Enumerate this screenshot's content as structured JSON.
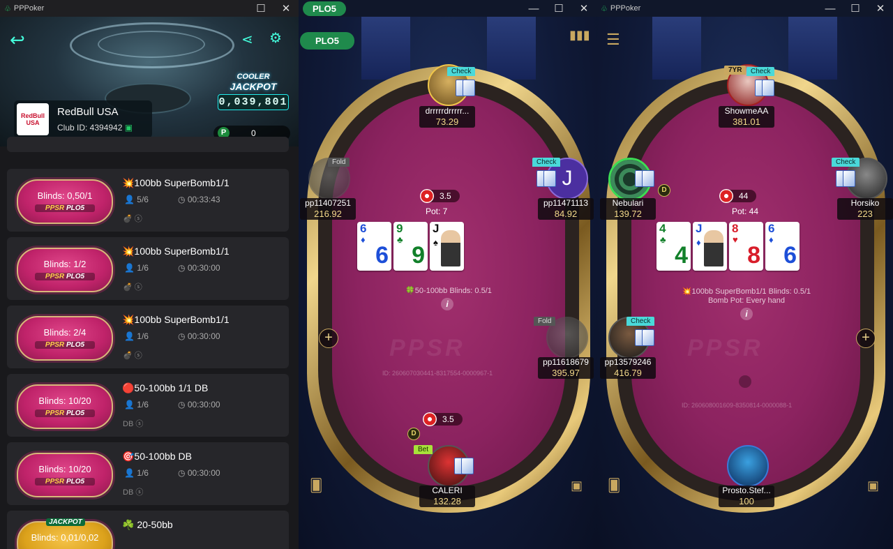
{
  "lobby": {
    "app_title": "PPPoker",
    "club_name": "RedBull USA",
    "club_id": "Club ID: 4394942",
    "club_logo_text": "RedBull USA",
    "jackpot_label_top": "COOLER",
    "jackpot_label": "JACKPOT",
    "jackpot_value": "0,039,801",
    "p_balance": "0",
    "games": [
      {
        "blinds": "Blinds:  0,50/1",
        "brand": "PPSR",
        "variant": "PLO5",
        "title": "💥100bb SuperBomb1/1",
        "players": "5/6",
        "time": "00:33:43",
        "icons": "💣 ⓢ"
      },
      {
        "blinds": "Blinds:  1/2",
        "brand": "PPSR",
        "variant": "PLO5",
        "title": "💥100bb SuperBomb1/1",
        "players": "1/6",
        "time": "00:30:00",
        "icons": "💣 ⓢ"
      },
      {
        "blinds": "Blinds:  2/4",
        "brand": "PPSR",
        "variant": "PLO5",
        "title": "💥100bb SuperBomb1/1",
        "players": "1/6",
        "time": "00:30:00",
        "icons": "💣 ⓢ"
      },
      {
        "blinds": "Blinds:  10/20",
        "brand": "PPSR",
        "variant": "PLO5",
        "title": "🔴50-100bb 1/1 DB",
        "players": "1/6",
        "time": "00:30:00",
        "icons": "DB ⓢ"
      },
      {
        "blinds": "Blinds:  10/20",
        "brand": "PPSR",
        "variant": "PLO5",
        "title": "🎯50-100bb DB",
        "players": "1/6",
        "time": "00:30:00",
        "icons": "DB ⓢ"
      },
      {
        "blinds": "Blinds:  0,01/0,02",
        "brand": "PPSR",
        "variant": "PLO5",
        "title": "☘️ 20-50bb",
        "players": "",
        "time": "",
        "icons": "",
        "jackpot": "JACKPOT"
      }
    ]
  },
  "table1": {
    "tab_label": "PLO5",
    "badge_label": "PLO5",
    "pot_chip_amount": "3.5",
    "pot": "Pot: 7",
    "board": [
      {
        "rank": "6",
        "suit": "♦",
        "color": "#1d4fd8"
      },
      {
        "rank": "9",
        "suit": "♣",
        "color": "#12802a"
      },
      {
        "rank": "J",
        "suit": "♠",
        "color": "#111111",
        "face": true
      }
    ],
    "info": "🍀50-100bb   Blinds: 0.5/1",
    "hand_id": "ID: 260607030441-8317554-0000967-1",
    "watermark": "PPSR",
    "bet_amount": "3.5",
    "players": [
      {
        "name": "drrrrrdrrrrr...",
        "stack": "73.29",
        "action": "Check"
      },
      {
        "name": "pp11407251",
        "stack": "216.92",
        "action": "Fold"
      },
      {
        "name": "pp11471113",
        "stack": "84.92",
        "action": "Check",
        "avatar_letter": "J"
      },
      {
        "name": "pp11618679",
        "stack": "395.97",
        "action": "Fold"
      },
      {
        "name": "CALERI",
        "stack": "132.28",
        "action": "Bet"
      }
    ]
  },
  "table2": {
    "app_title": "PPPoker",
    "pot_chip_amount": "44",
    "pot": "Pot: 44",
    "board": [
      {
        "rank": "4",
        "suit": "♣",
        "color": "#12802a"
      },
      {
        "rank": "J",
        "suit": "♦",
        "color": "#1d4fd8",
        "face": true
      },
      {
        "rank": "8",
        "suit": "♥",
        "color": "#d81d2a"
      },
      {
        "rank": "6",
        "suit": "♦",
        "color": "#1d4fd8"
      }
    ],
    "info": "💥100bb SuperBomb1/1   Blinds: 0.5/1",
    "info2": "Bomb Pot: Every hand",
    "hand_id": "ID: 260608001609-8350814-0000088-1",
    "watermark": "PPSR",
    "players": [
      {
        "name": "ShowmeAA",
        "stack": "381.01",
        "action": "Check",
        "tag": "7YR"
      },
      {
        "name": "Nebulari",
        "stack": "139.72",
        "action": ""
      },
      {
        "name": "Horsiko",
        "stack": "223",
        "action": "Check"
      },
      {
        "name": "pp13579246",
        "stack": "416.79",
        "action": "Check"
      },
      {
        "name": "Prosto.Stef...",
        "stack": "100",
        "action": ""
      }
    ]
  },
  "colors": {
    "felt": "#8c2360",
    "accent_green": "#1f8a4c",
    "gold": "#c9a860",
    "stack": "#f2d98a"
  },
  "icons": [
    "back-arrow-icon",
    "share-icon",
    "settings-gear-icon",
    "person-icon",
    "clock-icon",
    "chip-icon",
    "info-icon",
    "plus-icon",
    "spade-card-icon",
    "chat-off-icon",
    "stats-icon",
    "menu-icon"
  ]
}
